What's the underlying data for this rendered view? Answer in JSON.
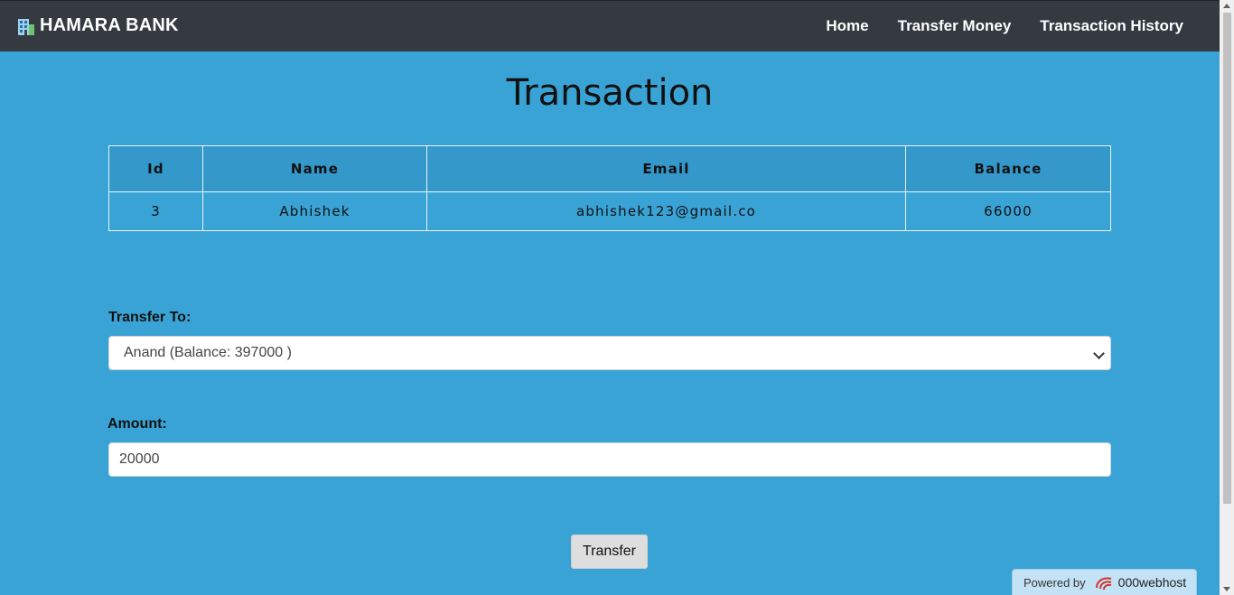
{
  "navbar": {
    "brand": "HAMARA BANK",
    "brand_icon": "building-icon",
    "links": [
      "Home",
      "Transfer Money",
      "Transaction History"
    ]
  },
  "page": {
    "title": "Transaction"
  },
  "account_table": {
    "headers": [
      "Id",
      "Name",
      "Email",
      "Balance"
    ],
    "row": [
      "3",
      "Abhishek",
      "abhishek123@gmail.co",
      "66000"
    ]
  },
  "form": {
    "transfer_to_label": "Transfer To:",
    "transfer_to_selected": "Anand (Balance: 397000 )",
    "amount_label": "Amount:",
    "amount_value": "20000",
    "submit_label": "Transfer"
  },
  "footer_badge": {
    "prefix": "Powered by",
    "brand": "000webhost",
    "icon": "000webhost-logo-icon"
  },
  "colors": {
    "background": "#3aa3d6",
    "navbar": "#343a40",
    "table_header": "#3598cb"
  }
}
